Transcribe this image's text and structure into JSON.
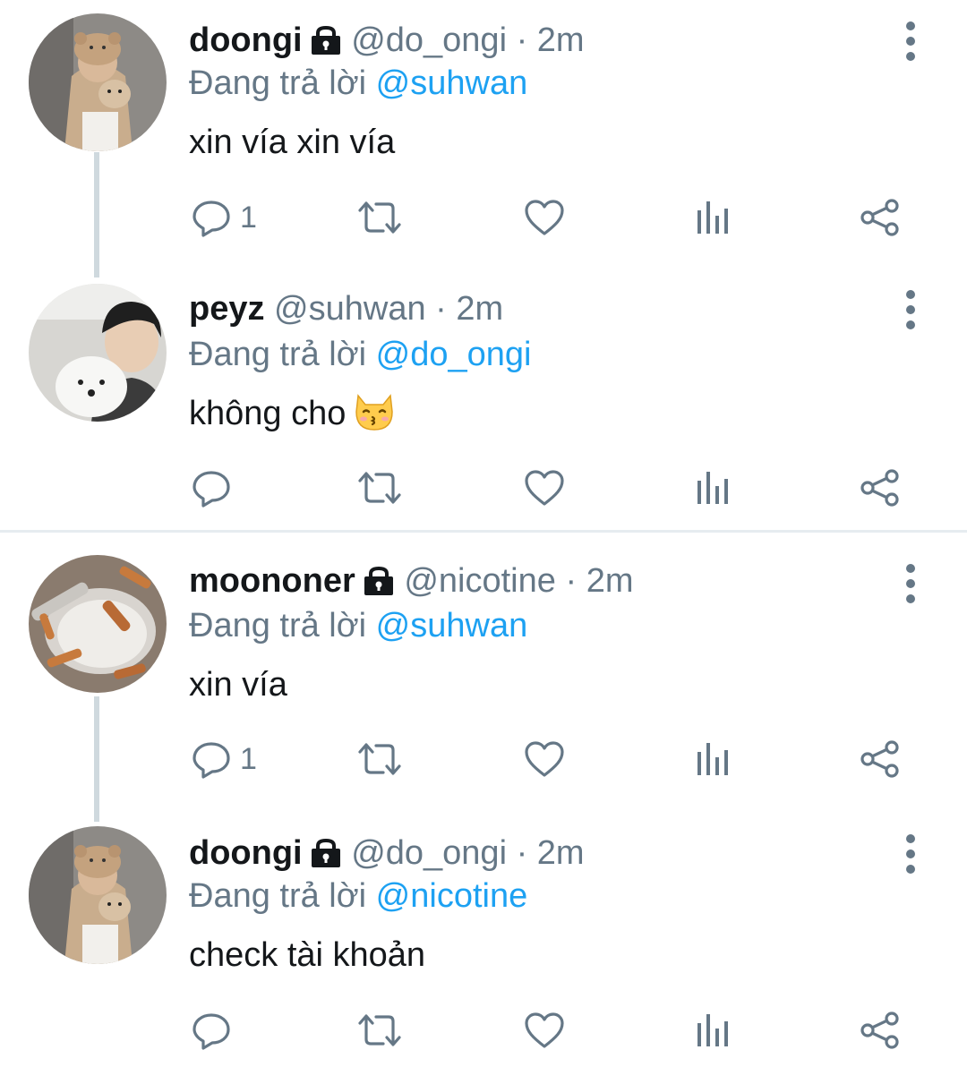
{
  "tweets": [
    {
      "name": "doongi",
      "handle": "@do_ongi",
      "time": "2m",
      "reply_prefix": "Đang trả lời",
      "reply_to": "@suhwan",
      "text": "xin vía xin vía",
      "reply_count": "1",
      "locked": true,
      "avatar": "bear-hat-person-avatar"
    },
    {
      "name": "peyz",
      "handle": "@suhwan",
      "time": "2m",
      "reply_prefix": "Đang trả lời",
      "reply_to": "@do_ongi",
      "text": "không cho",
      "emoji": "kissing-cat-emoji",
      "reply_count": "",
      "locked": false,
      "avatar": "person-with-dog-avatar"
    },
    {
      "name": "moononer",
      "handle": "@nicotine",
      "time": "2m",
      "reply_prefix": "Đang trả lời",
      "reply_to": "@suhwan",
      "text": "xin vía",
      "reply_count": "1",
      "locked": true,
      "avatar": "cigarettes-bowl-avatar"
    },
    {
      "name": "doongi",
      "handle": "@do_ongi",
      "time": "2m",
      "reply_prefix": "Đang trả lời",
      "reply_to": "@nicotine",
      "text": "check tài khoản",
      "reply_count": "",
      "locked": true,
      "avatar": "bear-hat-person-avatar"
    }
  ],
  "separator_dot": "·",
  "colors": {
    "text": "#14171a",
    "muted": "#657786",
    "accent": "#1da1f2",
    "line": "#cfd9de"
  },
  "icons": [
    "reply-icon",
    "retweet-icon",
    "like-icon",
    "analytics-icon",
    "share-icon",
    "more-options-icon",
    "lock-icon"
  ]
}
